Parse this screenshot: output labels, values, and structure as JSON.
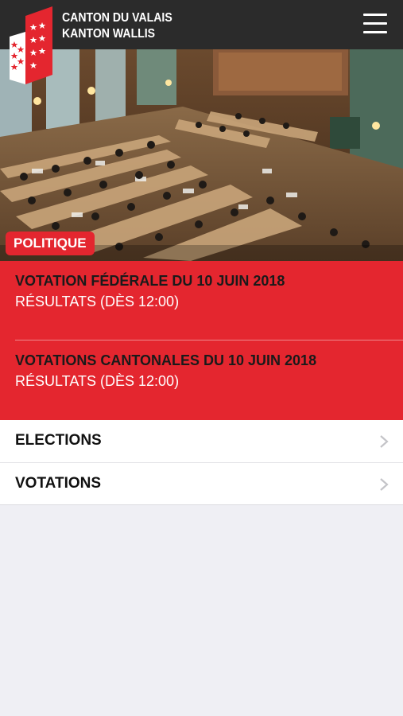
{
  "header": {
    "logo_line1": "CANTON DU VALAIS",
    "logo_line2": "KANTON WALLIS",
    "logo_icon": "valais-flag-icon",
    "menu_icon": "hamburger-menu-icon"
  },
  "hero": {
    "image": "parliament-chamber-photo",
    "category": "POLITIQUE"
  },
  "votes": [
    {
      "title": "VOTATION FÉDÉRALE DU 10 JUIN 2018",
      "subtitle": "RÉSULTATS (DÈS 12:00)"
    },
    {
      "title": "VOTATIONS CANTONALES DU 10 JUIN 2018",
      "subtitle": "RÉSULTATS (DÈS 12:00)"
    }
  ],
  "menu": [
    {
      "label": "ELECTIONS",
      "icon": "chevron-right-icon"
    },
    {
      "label": "VOTATIONS",
      "icon": "chevron-right-icon"
    }
  ],
  "colors": {
    "accent_red": "#e4262f",
    "header_bg": "#2b2b2b",
    "page_bg": "#efeff4"
  }
}
